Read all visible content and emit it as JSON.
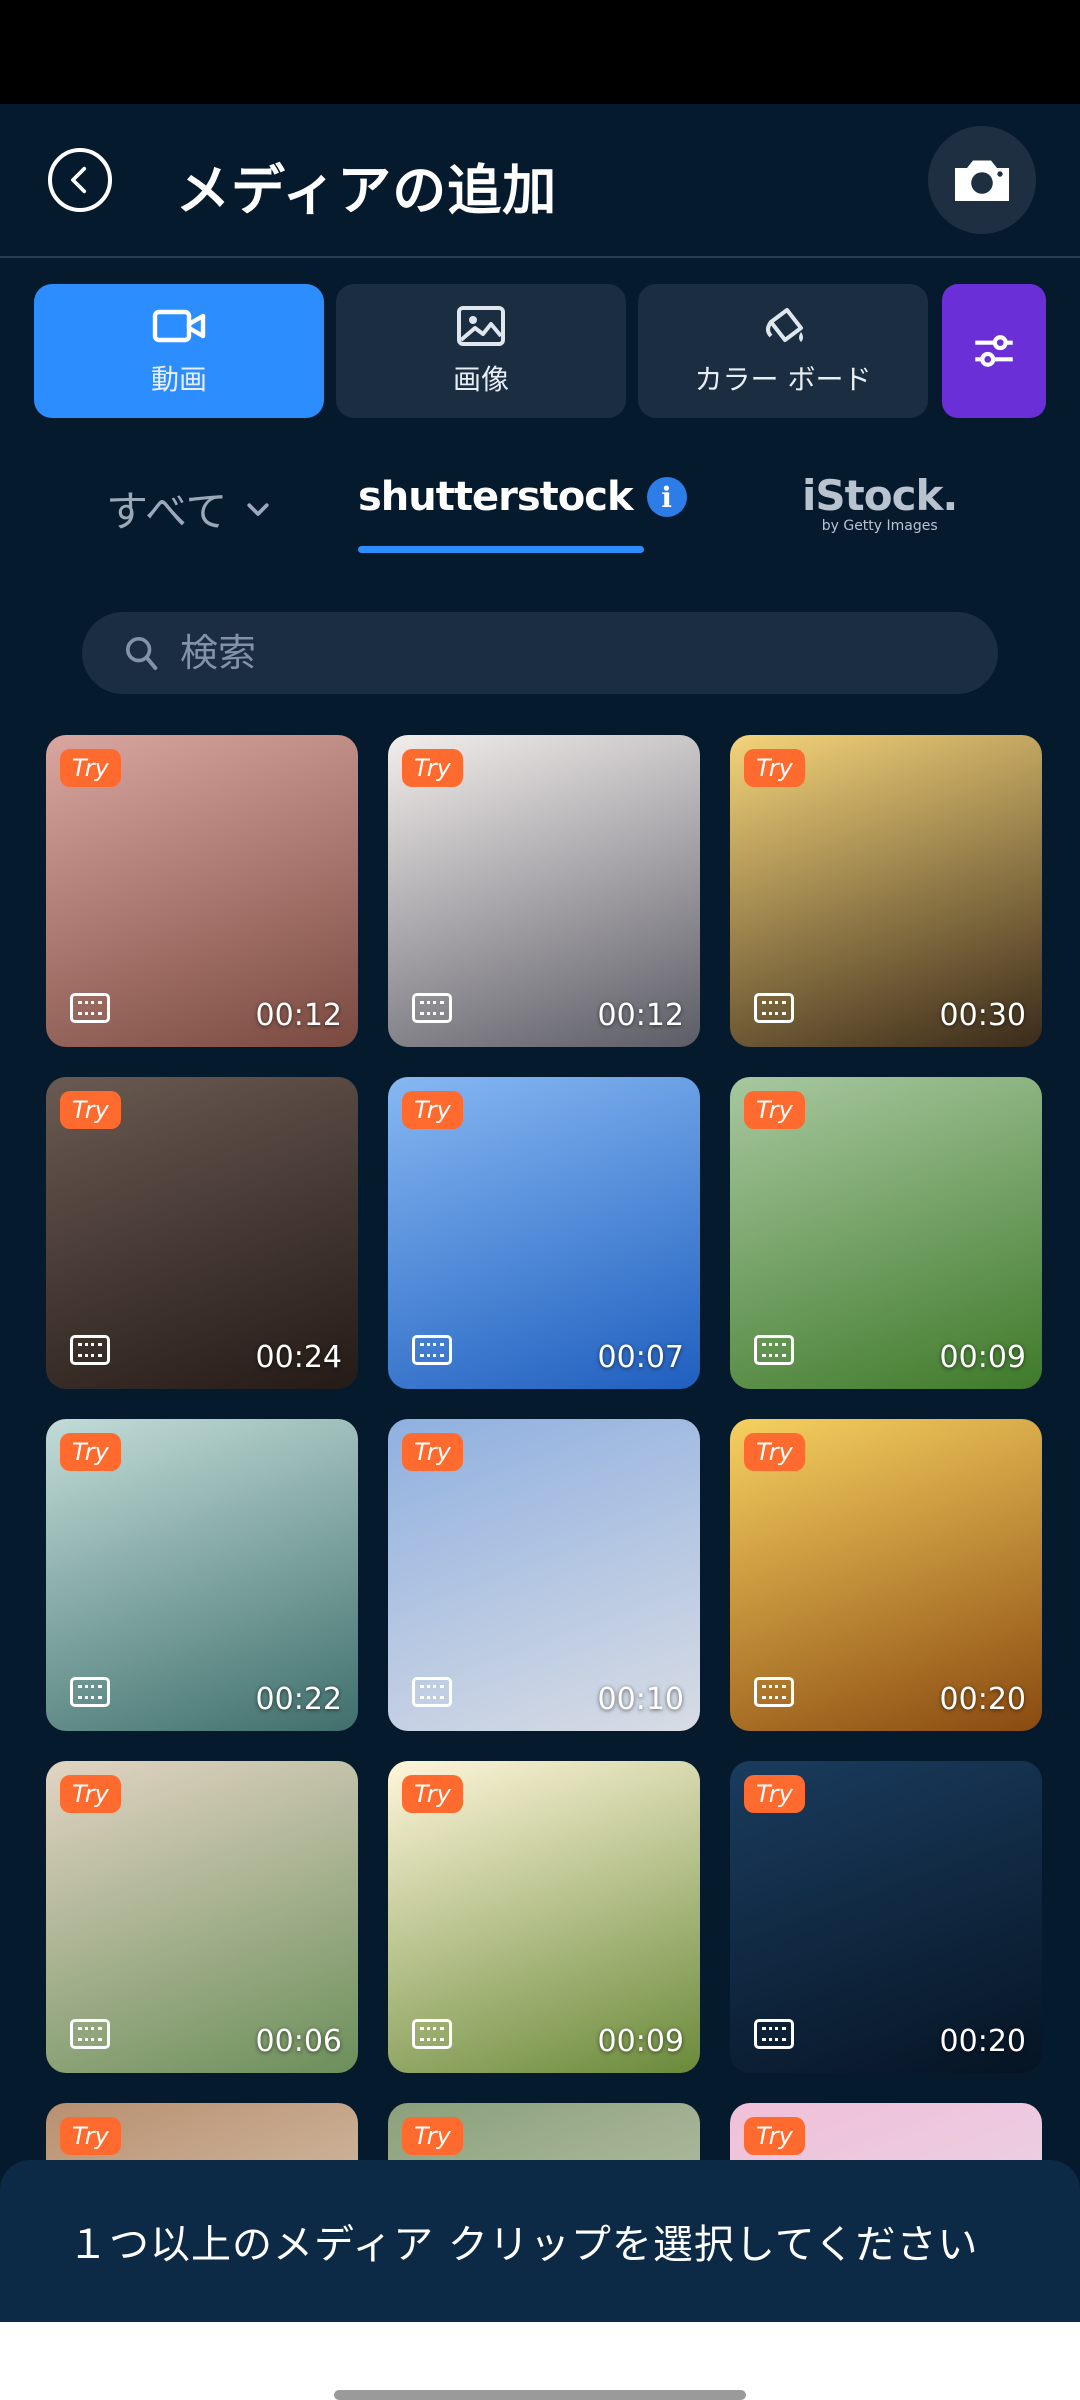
{
  "header": {
    "title": "メディアの追加"
  },
  "type_tabs": [
    {
      "label": "動画",
      "icon": "video-icon",
      "active": true
    },
    {
      "label": "画像",
      "icon": "image-icon",
      "active": false
    },
    {
      "label": "カラー ボード",
      "icon": "paint-bucket-icon",
      "active": false
    }
  ],
  "source_tabs": {
    "all_label": "すべて",
    "shutterstock_label": "shutterstock",
    "shutterstock_info": "i",
    "istock_label": "iStock.",
    "istock_sub": "by Getty Images"
  },
  "search": {
    "placeholder": "検索"
  },
  "badge_label": "Try",
  "clips": [
    {
      "duration": "00:12",
      "colors": [
        "#d9a6a0",
        "#7a4a40"
      ]
    },
    {
      "duration": "00:12",
      "colors": [
        "#f2eeec",
        "#5c5c66"
      ]
    },
    {
      "duration": "00:30",
      "colors": [
        "#f4d47a",
        "#3a2a1a"
      ]
    },
    {
      "duration": "00:24",
      "colors": [
        "#6a5a52",
        "#241a16"
      ]
    },
    {
      "duration": "00:07",
      "colors": [
        "#86b8f2",
        "#1f5fbf"
      ]
    },
    {
      "duration": "00:09",
      "colors": [
        "#a8c8a0",
        "#3f7a2a"
      ]
    },
    {
      "duration": "00:22",
      "colors": [
        "#c2dcd8",
        "#3f6f6c"
      ]
    },
    {
      "duration": "00:10",
      "colors": [
        "#8fb0e0",
        "#d8dce4"
      ]
    },
    {
      "duration": "00:20",
      "colors": [
        "#f6d060",
        "#8a4a10"
      ]
    },
    {
      "duration": "00:06",
      "colors": [
        "#e2d4c4",
        "#6b8f5a"
      ]
    },
    {
      "duration": "00:09",
      "colors": [
        "#fff6da",
        "#6a8a3a"
      ]
    },
    {
      "duration": "00:20",
      "colors": [
        "#1a3c5e",
        "#061424"
      ]
    },
    {
      "duration": "",
      "colors": [
        "#b89070",
        "#e8e0d0"
      ]
    },
    {
      "duration": "",
      "colors": [
        "#8aa07a",
        "#d8d8c8"
      ]
    },
    {
      "duration": "",
      "colors": [
        "#f0c0d8",
        "#e6e0ee"
      ]
    }
  ],
  "toast": {
    "message": "１つ以上のメディア クリップを選択してください"
  }
}
